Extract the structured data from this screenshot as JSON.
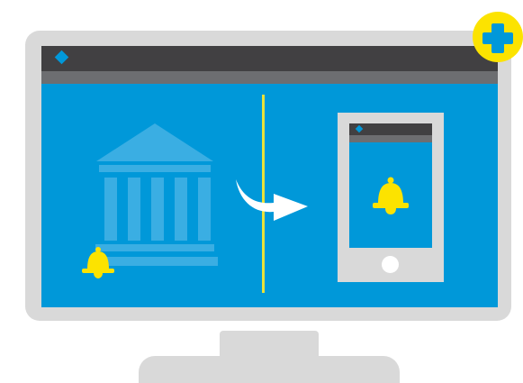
{
  "illustration": {
    "icons": {
      "monitor": "monitor-icon",
      "bank": "bank-building-icon",
      "desktop_bell": "bell-icon",
      "arrow": "curved-arrow-icon",
      "phone": "smartphone-icon",
      "phone_bell": "bell-icon",
      "add_badge": "plus-icon"
    },
    "colors": {
      "screen_blue": "#0098d9",
      "window_bar": "#414042",
      "window_subbar": "#6d6e71",
      "device_frame": "#d9d9d9",
      "bell_yellow": "#fce300",
      "divider_yellow": "#e8e23a",
      "arrow_white": "#ffffff",
      "bank_blue": "#3aaee3"
    }
  }
}
